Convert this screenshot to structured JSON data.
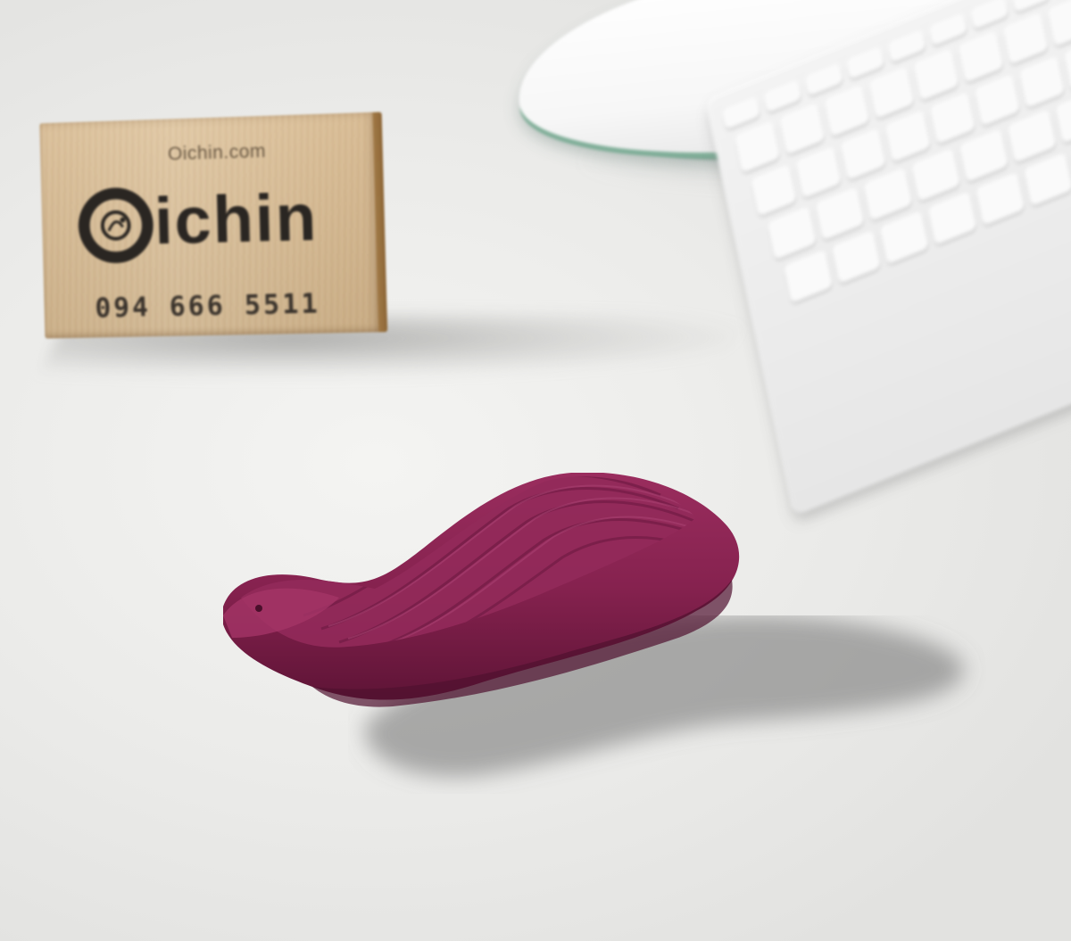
{
  "scene": {
    "background_color": "#ececea",
    "sign": {
      "url_text": "Oichin.com",
      "logo_text": "ichin",
      "phone_text": "094 666 5511",
      "wood_color": "#dcbf96",
      "ink_color": "#2a2622"
    },
    "mouse": {
      "top_color": "#f7f7f7",
      "base_color": "#7fae98"
    },
    "keyboard": {
      "key_color": "#fafafa"
    },
    "product": {
      "color": "#86224f"
    }
  }
}
